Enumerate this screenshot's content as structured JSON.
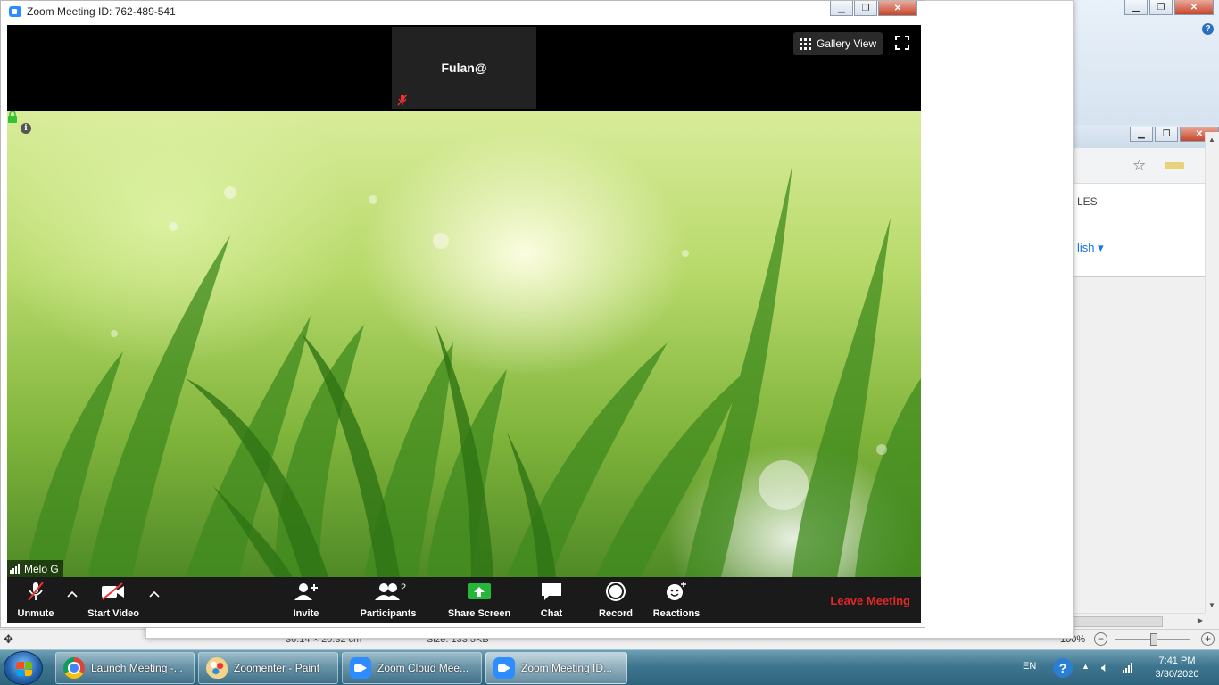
{
  "zoom": {
    "title": "Zoom Meeting ID: 762-489-541",
    "thumbnail_name": "Fulan@",
    "gallery_view_label": "Gallery View",
    "video_name": "Melo G",
    "toolbar": {
      "unmute": "Unmute",
      "start_video": "Start Video",
      "invite": "Invite",
      "participants": "Participants",
      "participants_count": "2",
      "share_screen": "Share Screen",
      "chat": "Chat",
      "record": "Record",
      "reactions": "Reactions",
      "leave": "Leave Meeting"
    },
    "colors": {
      "accent": "#2d8cff",
      "leave": "#e02828",
      "share": "#26b63a"
    }
  },
  "background_window": {
    "tab_partial_label": "LES",
    "close_tab": "×",
    "language_partial": "lish ▾"
  },
  "paint_status": {
    "dimensions": "36.14 × 20.32 cm",
    "size": "Size: 133.5KB",
    "zoom": "100%"
  },
  "taskbar": {
    "items": [
      {
        "label": "Launch Meeting -...",
        "icon": "chrome-icon"
      },
      {
        "label": "Zoomenter - Paint",
        "icon": "paint-icon"
      },
      {
        "label": "Zoom Cloud Mee...",
        "icon": "zoom-icon"
      },
      {
        "label": "Zoom Meeting ID...",
        "icon": "zoom-icon"
      }
    ],
    "language": "EN",
    "time": "7:41 PM",
    "date": "3/30/2020"
  }
}
